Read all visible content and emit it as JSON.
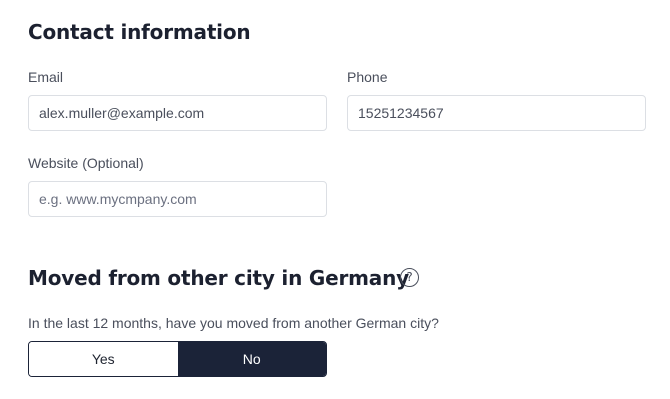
{
  "contact": {
    "title": "Contact information",
    "email": {
      "label": "Email",
      "value": "alex.muller@example.com"
    },
    "phone": {
      "label": "Phone",
      "value": "15251234567"
    },
    "website": {
      "label": "Website (Optional)",
      "value": "",
      "placeholder": "e.g. www.mycmpany.com"
    }
  },
  "moved": {
    "title": "Moved from other city in Germany",
    "help_icon": "question-circle-icon",
    "help_glyph": "?",
    "question": "In the last 12 months, have you moved from another German city?",
    "options": [
      "Yes",
      "No"
    ],
    "selected": "No"
  },
  "colors": {
    "selected_bg": "#1b2338",
    "border": "#dcdfe4",
    "text": "#1f2430"
  }
}
